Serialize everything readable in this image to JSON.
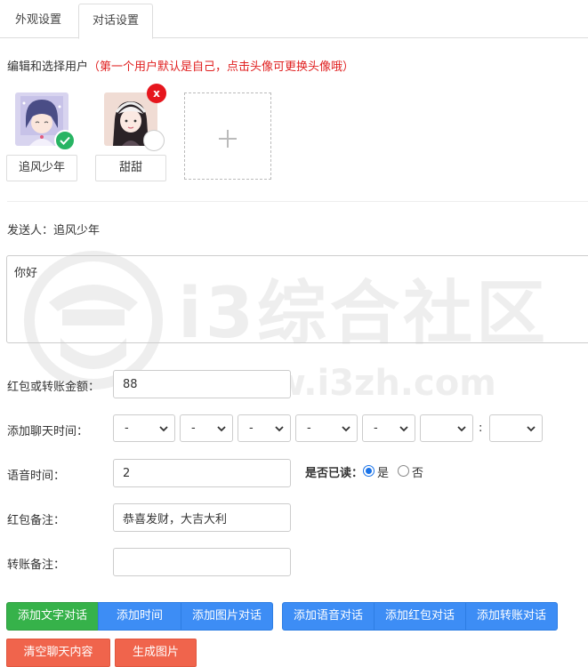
{
  "tabs": [
    {
      "label": "外观设置"
    },
    {
      "label": "对话设置"
    }
  ],
  "hint": {
    "main": "编辑和选择用户",
    "warn": "（第一个用户默认是自己，点击头像可更换头像哦）"
  },
  "users": [
    {
      "name": "追风少年",
      "selected": true
    },
    {
      "name": "甜甜",
      "selected": false,
      "delete_label": "x"
    }
  ],
  "sender": {
    "label": "发送人：",
    "name": "追风少年"
  },
  "message": {
    "value": "你好"
  },
  "watermark": {
    "logo_text": "i3综合社区",
    "url_text": "www.i3zh.com"
  },
  "form": {
    "amount": {
      "label": "红包或转账金额：",
      "value": "88"
    },
    "time": {
      "label": "添加聊天时间：",
      "selects": [
        "-",
        "-",
        "-",
        "-",
        "-",
        "",
        ""
      ],
      "colon": ":"
    },
    "voice": {
      "label": "语音时间：",
      "value": "2"
    },
    "read": {
      "label": "是否已读：",
      "yes": "是",
      "no": "否",
      "selected": "是"
    },
    "redpacket_note": {
      "label": "红包备注：",
      "value": "恭喜发财，大吉大利"
    },
    "transfer_note": {
      "label": "转账备注：",
      "value": ""
    }
  },
  "buttons": {
    "add_text": "添加文字对话",
    "add_time": "添加时间",
    "add_image": "添加图片对话",
    "add_voice": "添加语音对话",
    "add_redpacket": "添加红包对话",
    "add_transfer": "添加转账对话",
    "clear": "清空聊天内容",
    "generate": "生成图片"
  },
  "colors": {
    "green": "#36b24a",
    "blue": "#3d8df5",
    "red": "#f0644c",
    "warn": "#e02020"
  }
}
